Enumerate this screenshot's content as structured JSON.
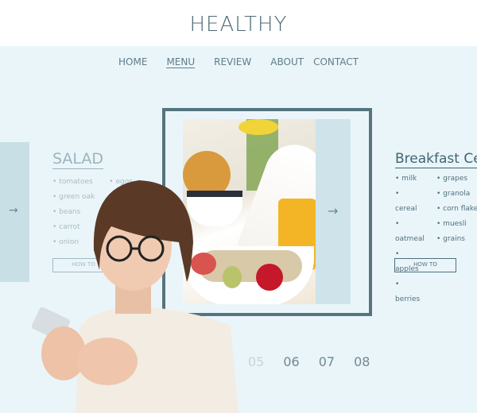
{
  "header": {
    "title": "HEALTHY"
  },
  "nav": {
    "items": [
      "HOME",
      "MENU",
      "REVIEW",
      "ABOUT",
      "CONTACT"
    ],
    "active": "MENU"
  },
  "salad": {
    "title": "SALAD",
    "col1": [
      "tomatoes",
      "green oak",
      "beans",
      "carrot",
      "onion"
    ],
    "col2": [
      "eggs"
    ],
    "button": "HOW TO"
  },
  "breakfast": {
    "title": "Breakfast Ce",
    "col1": [
      "milk",
      "cereal",
      "oatmeal",
      "apples",
      "berries"
    ],
    "col2": [
      "grapes",
      "granola",
      "corn flakes",
      "muesli",
      "grains"
    ],
    "button": "HOW TO"
  },
  "pager": [
    "05",
    "06",
    "07",
    "08"
  ],
  "icons": {
    "left_arrow": "arrow-right-icon",
    "slider_arrow": "arrow-right-icon"
  },
  "colors": {
    "accent": "#55747e",
    "background": "#eaf5fa"
  }
}
